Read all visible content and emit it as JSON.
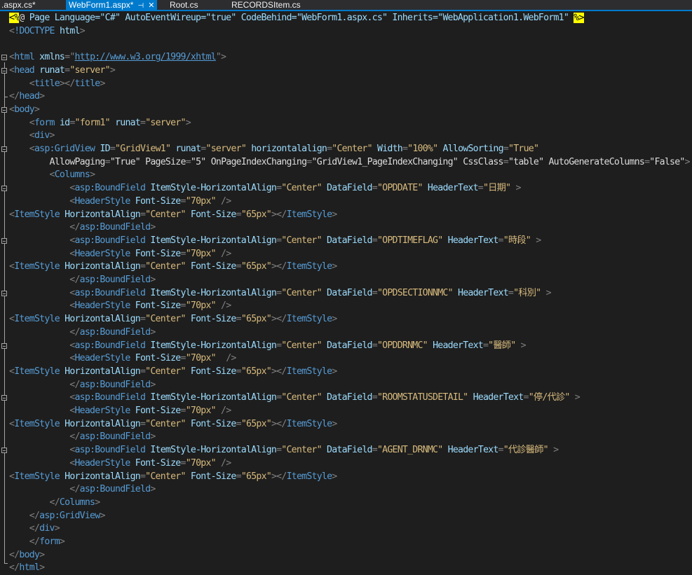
{
  "tabs": [
    {
      "label": ".aspx.cs*"
    },
    {
      "label": "WebForm1.aspx*",
      "active": true
    },
    {
      "label": "Root.cs"
    },
    {
      "label": "RECORDSItem.cs"
    }
  ],
  "code_lines": [
    "<%@ Page Language=\"C#\" AutoEventWireup=\"true\" CodeBehind=\"WebForm1.aspx.cs\" Inherits=\"WebApplication1.WebForm1\" %>",
    "<!DOCTYPE html>",
    "",
    "<html xmlns=\"http://www.w3.org/1999/xhtml\">",
    "<head runat=\"server\">",
    "    <title></title>",
    "</head>",
    "<body>",
    "    <form id=\"form1\" runat=\"server\">",
    "    <div>",
    "    <asp:GridView ID=\"GridView1\" runat=\"server\" horizontalalign=\"Center\" Width=\"100%\" AllowSorting=\"True\"",
    "        AllowPaging=\"True\" PageSize=\"5\" OnPageIndexChanging=\"GridView1_PageIndexChanging\" CssClass=\"table\" AutoGenerateColumns=\"False\">",
    "        <Columns>",
    "            <asp:BoundField ItemStyle-HorizontalAlign=\"Center\" DataField=\"OPDDATE\" HeaderText=\"日期\" >",
    "            <HeaderStyle Font-Size=\"70px\" />",
    "<ItemStyle HorizontalAlign=\"Center\" Font-Size=\"65px\"></ItemStyle>",
    "            </asp:BoundField>",
    "            <asp:BoundField ItemStyle-HorizontalAlign=\"Center\" DataField=\"OPDTIMEFLAG\" HeaderText=\"時段\" >",
    "            <HeaderStyle Font-Size=\"70px\" />",
    "<ItemStyle HorizontalAlign=\"Center\" Font-Size=\"65px\"></ItemStyle>",
    "            </asp:BoundField>",
    "            <asp:BoundField ItemStyle-HorizontalAlign=\"Center\" DataField=\"OPDSECTIONNMC\" HeaderText=\"科別\" >",
    "            <HeaderStyle Font-Size=\"70px\" />",
    "<ItemStyle HorizontalAlign=\"Center\" Font-Size=\"65px\"></ItemStyle>",
    "            </asp:BoundField>",
    "            <asp:BoundField ItemStyle-HorizontalAlign=\"Center\" DataField=\"OPDDRNMC\" HeaderText=\"醫師\" >",
    "            <HeaderStyle Font-Size=\"70px\"  />",
    "<ItemStyle HorizontalAlign=\"Center\" Font-Size=\"65px\"></ItemStyle>",
    "            </asp:BoundField>",
    "            <asp:BoundField ItemStyle-HorizontalAlign=\"Center\" DataField=\"ROOMSTATUSDETAIL\" HeaderText=\"停/代診\" >",
    "            <HeaderStyle Font-Size=\"70px\" />",
    "<ItemStyle HorizontalAlign=\"Center\" Font-Size=\"65px\"></ItemStyle>",
    "            </asp:BoundField>",
    "            <asp:BoundField ItemStyle-HorizontalAlign=\"Center\" DataField=\"AGENT_DRNMC\" HeaderText=\"代診醫師\" >",
    "            <HeaderStyle Font-Size=\"70px\" />",
    "<ItemStyle HorizontalAlign=\"Center\" Font-Size=\"65px\"></ItemStyle>",
    "            </asp:BoundField>",
    "        </Columns>",
    "    </asp:GridView>",
    "    </div>",
    "    </form>",
    "</body>",
    "</html>"
  ],
  "colors": {
    "background": "#1e1e1e",
    "tag": "#569cd6",
    "attribute": "#9cdcfe",
    "value": "#d7ba7d",
    "delimiter": "#808080",
    "active_tab": "#007acc"
  },
  "icons": [
    "pin-icon",
    "close-icon",
    "fold-toggle-icon"
  ]
}
